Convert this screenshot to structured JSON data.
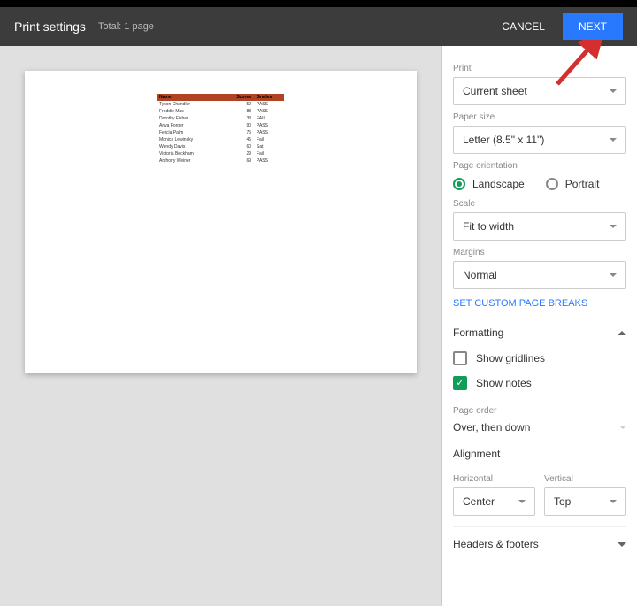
{
  "header": {
    "title": "Print settings",
    "subtitle": "Total: 1 page",
    "cancel": "CANCEL",
    "next": "NEXT"
  },
  "preview": {
    "headers": [
      "Name",
      "Scores",
      "Grades"
    ],
    "rows": [
      {
        "name": "Tyson Chandler",
        "score": "52",
        "grade": "PASS"
      },
      {
        "name": "Freddie Mac",
        "score": "88",
        "grade": "PASS"
      },
      {
        "name": "Dorothy Fisher",
        "score": "33",
        "grade": "FAIL"
      },
      {
        "name": "Anya Forger",
        "score": "90",
        "grade": "PASS"
      },
      {
        "name": "Felicia Palm",
        "score": "75",
        "grade": "PASS"
      },
      {
        "name": "Monica Lewinsky",
        "score": "45",
        "grade": "Fail"
      },
      {
        "name": "Wendy Davis",
        "score": "60",
        "grade": "Sat"
      },
      {
        "name": "Victoria Beckham",
        "score": "29",
        "grade": "Fail"
      },
      {
        "name": "Anthony Weiner",
        "score": "69",
        "grade": "PASS"
      }
    ]
  },
  "sidebar": {
    "print": {
      "label": "Print",
      "value": "Current sheet"
    },
    "paper": {
      "label": "Paper size",
      "value": "Letter (8.5\" x 11\")"
    },
    "orientation": {
      "label": "Page orientation",
      "landscape": "Landscape",
      "portrait": "Portrait"
    },
    "scale": {
      "label": "Scale",
      "value": "Fit to width"
    },
    "margins": {
      "label": "Margins",
      "value": "Normal"
    },
    "custom_breaks": "SET CUSTOM PAGE BREAKS",
    "formatting": {
      "title": "Formatting",
      "gridlines": "Show gridlines",
      "notes": "Show notes"
    },
    "page_order": {
      "label": "Page order",
      "value": "Over, then down"
    },
    "alignment": {
      "title": "Alignment",
      "horizontal_label": "Horizontal",
      "horizontal_value": "Center",
      "vertical_label": "Vertical",
      "vertical_value": "Top"
    },
    "headers_footers": "Headers & footers"
  }
}
